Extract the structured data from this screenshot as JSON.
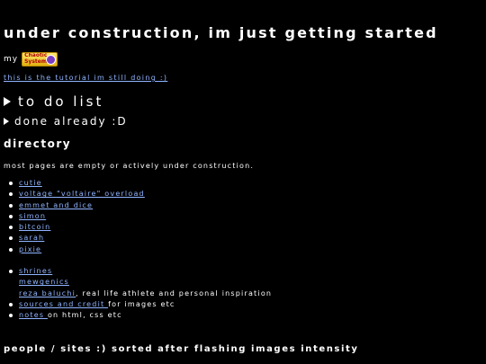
{
  "page": {
    "title": "under construction, im just getting started",
    "my_label": "my",
    "badge_text": "Chaotic System",
    "tutorial_link": "this is the tutorial im still doing :)",
    "todo_summary": "to do list",
    "done_summary": "done already :D",
    "directory_heading": "directory",
    "directory_note": "most pages are empty or actively under construction.",
    "pages": [
      "cutie",
      "voltage \"voltaire\" overload",
      "emmet and dice",
      "simon",
      "bitcoin",
      "sarah",
      "pixie"
    ],
    "extras": {
      "shrines": "shrines",
      "mewgenics": "mewgenics",
      "reza_link": "reza baluchi",
      "reza_text": ", real life athlete and personal inspiration",
      "sources_link": "sources and credit ",
      "sources_text": "for images etc",
      "notes_link": "notes ",
      "notes_text": "on html, css etc"
    },
    "people_heading": "people / sites :) sorted after flashing images intensity"
  },
  "colors": {
    "background": "#000000",
    "text": "#ffffff",
    "link": "#8fb4ff"
  }
}
